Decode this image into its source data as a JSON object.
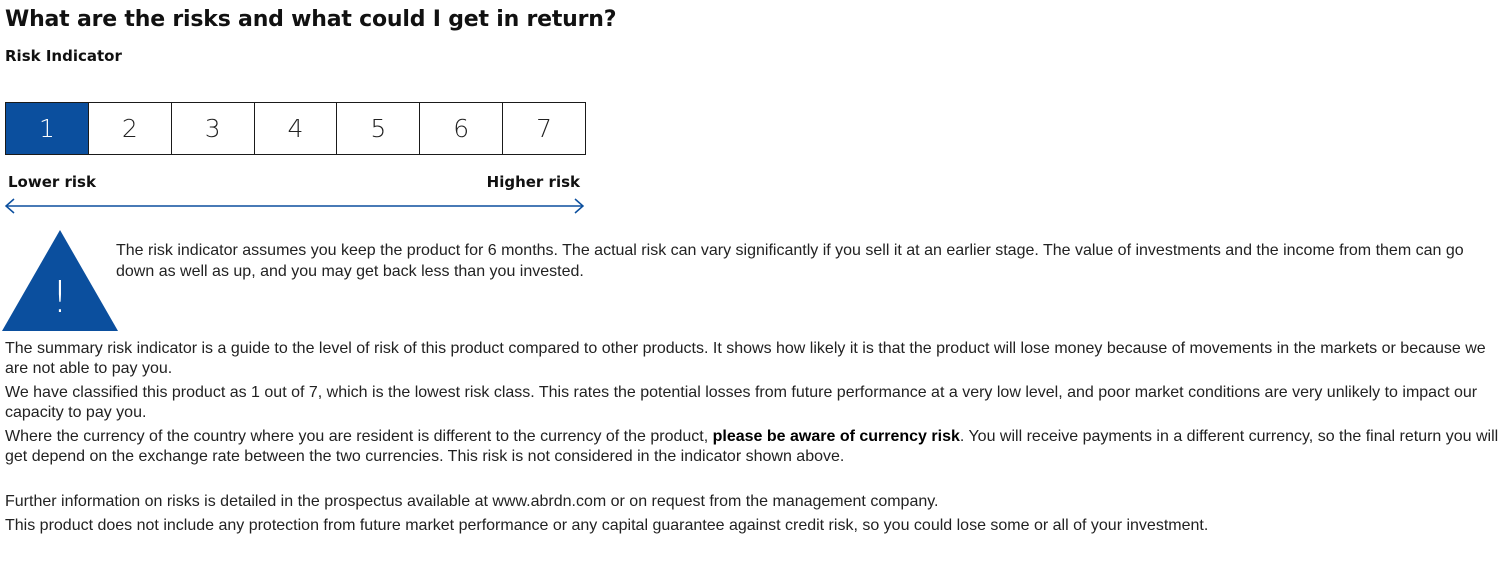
{
  "heading": "What are the risks and what could I get in return?",
  "subheading": "Risk Indicator",
  "risk_scale": {
    "levels": [
      "1",
      "2",
      "3",
      "4",
      "5",
      "6",
      "7"
    ],
    "selected": 1,
    "lower_label": "Lower risk",
    "higher_label": "Higher risk",
    "active_color": "#0b4f9e"
  },
  "warning": {
    "icon": "warning-triangle-icon",
    "symbol": "!",
    "text": "The risk indicator assumes you keep the product for 6 months. The actual risk can vary significantly if you sell it at an earlier stage. The value of investments and the income from them can go down as well as up, and you may get back less than you invested."
  },
  "paragraphs": {
    "summary": "The summary risk indicator is a guide to the level of risk of this product compared to other products. It shows how likely it is that the product will lose money because of movements in the markets or because we are not able to pay you.",
    "classification": "We have classified this product as 1 out of 7, which is the lowest risk class. This rates the potential losses from future performance at a very low level, and poor market conditions are very unlikely to impact our capacity to pay you.",
    "currency_before": "Where the currency of the country where you are resident is different to the currency of the product, ",
    "currency_emphasis": "please be aware of currency risk",
    "currency_after": ". You will receive payments in a different currency, so the final return you will get depend on the exchange rate between the two currencies. This risk is not considered in the indicator shown above.",
    "further_info": "Further information on risks is detailed in the prospectus available at www.abrdn.com or on request from the management company.",
    "protection": "This product does not include any protection from future market performance or any capital guarantee against credit risk, so you could lose some or all of your investment."
  }
}
